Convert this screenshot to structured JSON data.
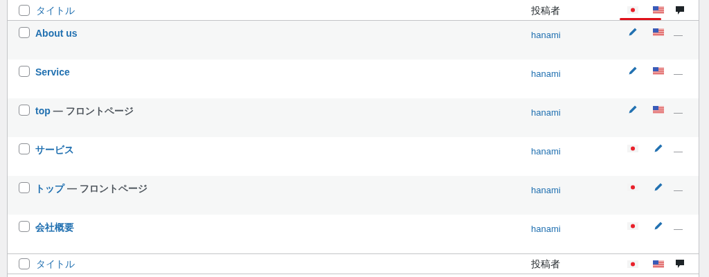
{
  "header": {
    "checked": false,
    "title_label": "タイトル",
    "author_label": "投稿者",
    "languages": [
      {
        "kind": "ja"
      },
      {
        "kind": "en"
      }
    ],
    "languages_underlined": true
  },
  "rows": [
    {
      "checked": false,
      "title": "About us",
      "author": "hanami",
      "translations": [
        {
          "kind": "edit"
        },
        {
          "kind": "en"
        }
      ],
      "comments": "—"
    },
    {
      "checked": false,
      "title": "Service",
      "author": "hanami",
      "translations": [
        {
          "kind": "edit"
        },
        {
          "kind": "en"
        }
      ],
      "comments": "—"
    },
    {
      "checked": false,
      "title": "top",
      "state": "— フロントページ",
      "author": "hanami",
      "translations": [
        {
          "kind": "edit"
        },
        {
          "kind": "en"
        }
      ],
      "comments": "—"
    },
    {
      "checked": false,
      "title": "サービス",
      "author": "hanami",
      "translations": [
        {
          "kind": "ja"
        },
        {
          "kind": "edit"
        }
      ],
      "comments": "—"
    },
    {
      "checked": false,
      "title": "トップ",
      "state": "— フロントページ",
      "author": "hanami",
      "translations": [
        {
          "kind": "ja"
        },
        {
          "kind": "edit"
        }
      ],
      "comments": "—"
    },
    {
      "checked": false,
      "title": "会社概要",
      "author": "hanami",
      "translations": [
        {
          "kind": "ja"
        },
        {
          "kind": "edit"
        }
      ],
      "comments": "—"
    }
  ],
  "footer": {
    "checked": false,
    "title_label": "タイトル",
    "author_label": "投稿者",
    "languages": [
      {
        "kind": "ja"
      },
      {
        "kind": "en"
      }
    ]
  }
}
